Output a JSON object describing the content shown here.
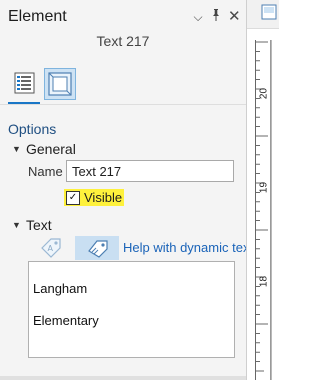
{
  "panel": {
    "title": "Element",
    "subtitle": "Text 217",
    "header_icons": {
      "menu": "chevron-down-icon",
      "pin": "pin-icon",
      "close": "close-icon"
    }
  },
  "tabs": [
    {
      "name": "text-properties-tab",
      "icon": "text-list-icon",
      "active": true
    },
    {
      "name": "display-tab",
      "icon": "frame-display-icon",
      "active": false
    }
  ],
  "options": {
    "label": "Options",
    "general": {
      "label": "General",
      "name_label": "Name",
      "name_value": "Text 217",
      "visible_label": "Visible",
      "visible_checked": true
    },
    "text": {
      "label": "Text",
      "help_link": "Help with dynamic text",
      "content_line1": "Langham",
      "content_line2": "Elementary"
    }
  },
  "ruler": {
    "numbers": [
      "20",
      "19",
      "18"
    ]
  },
  "colors": {
    "accent": "#1976c6",
    "highlight": "#fef13c",
    "link": "#1a63b8"
  }
}
